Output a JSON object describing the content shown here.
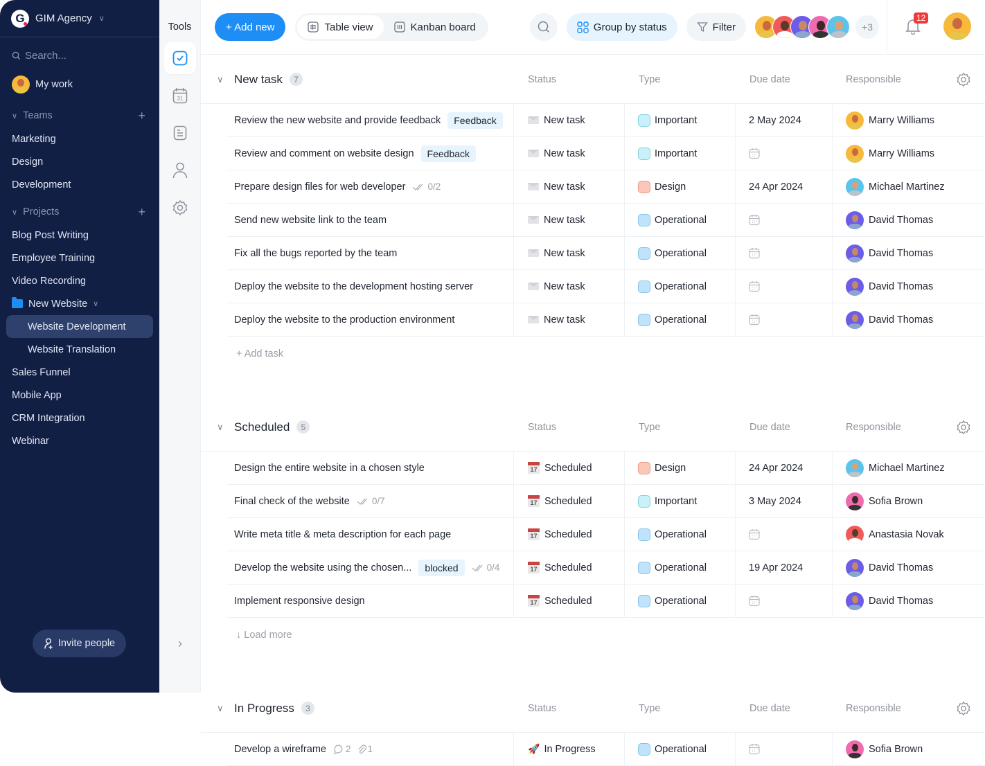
{
  "workspace": {
    "name": "GIM Agency"
  },
  "sidebar": {
    "search_placeholder": "Search...",
    "my_work": "My work",
    "teams_label": "Teams",
    "teams": [
      "Marketing",
      "Design",
      "Development"
    ],
    "projects_label": "Projects",
    "projects": {
      "p0": "Blog Post Writing",
      "p1": "Employee Training",
      "p2": "Video Recording",
      "folder": "New Website",
      "sub0": "Website Development",
      "sub1": "Website Translation",
      "p3": "Sales Funnel",
      "p4": "Mobile App",
      "p5": "CRM Integration",
      "p6": "Webinar"
    },
    "invite": "Invite people"
  },
  "tools": {
    "title": "Tools"
  },
  "toolbar": {
    "add_new": "+ Add new",
    "table_view": "Table view",
    "kanban": "Kanban board",
    "group_by": "Group by status",
    "filter": "Filter",
    "more_members": "+3",
    "notifications": "12"
  },
  "columns": {
    "status": "Status",
    "type": "Type",
    "due": "Due date",
    "responsible": "Responsible"
  },
  "colors": {
    "accent": "#1c8ef5",
    "sidebar": "#121f45",
    "important": "#c9f1f9",
    "design": "#fbc7b9",
    "operational": "#bfe3fb"
  },
  "groups": [
    {
      "title": "New task",
      "count": "7",
      "footer": "+ Add task",
      "rows": [
        {
          "name": "Review the new website and provide feedback",
          "tag": "Feedback",
          "meta": "",
          "status": "New task",
          "type": "Important",
          "due": "2 May 2024",
          "resp": "Marry Williams"
        },
        {
          "name": "Review and comment on website design",
          "tag": "Feedback",
          "meta": "",
          "status": "New task",
          "type": "Important",
          "due": "",
          "resp": "Marry Williams"
        },
        {
          "name": "Prepare design files for web developer",
          "tag": "",
          "meta": "0/2",
          "status": "New task",
          "type": "Design",
          "due": "24 Apr 2024",
          "resp": "Michael Martinez"
        },
        {
          "name": "Send new website link to the team",
          "tag": "",
          "meta": "",
          "status": "New task",
          "type": "Operational",
          "due": "",
          "resp": "David Thomas"
        },
        {
          "name": "Fix all the bugs reported by the team",
          "tag": "",
          "meta": "",
          "status": "New task",
          "type": "Operational",
          "due": "",
          "resp": "David Thomas"
        },
        {
          "name": "Deploy the website to the development hosting server",
          "tag": "",
          "meta": "",
          "status": "New task",
          "type": "Operational",
          "due": "",
          "resp": "David Thomas"
        },
        {
          "name": "Deploy the website to the production environment",
          "tag": "",
          "meta": "",
          "status": "New task",
          "type": "Operational",
          "due": "",
          "resp": "David Thomas"
        }
      ]
    },
    {
      "title": "Scheduled",
      "count": "5",
      "footer": "↓ Load more",
      "rows": [
        {
          "name": "Design the entire website in a chosen style",
          "tag": "",
          "meta": "",
          "status": "Scheduled",
          "type": "Design",
          "due": "24 Apr 2024",
          "resp": "Michael Martinez"
        },
        {
          "name": "Final check of the website",
          "tag": "",
          "meta": "0/7",
          "status": "Scheduled",
          "type": "Important",
          "due": "3 May 2024",
          "resp": "Sofia Brown"
        },
        {
          "name": "Write meta title & meta description for each page",
          "tag": "",
          "meta": "",
          "status": "Scheduled",
          "type": "Operational",
          "due": "",
          "resp": "Anastasia Novak"
        },
        {
          "name": "Develop the website using the chosen...",
          "tag": "blocked",
          "meta": "0/4",
          "status": "Scheduled",
          "type": "Operational",
          "due": "19 Apr 2024",
          "resp": "David Thomas"
        },
        {
          "name": "Implement responsive design",
          "tag": "",
          "meta": "",
          "status": "Scheduled",
          "type": "Operational",
          "due": "",
          "resp": "David Thomas"
        }
      ]
    },
    {
      "title": "In Progress",
      "count": "3",
      "footer": "",
      "rows": [
        {
          "name": "Develop a wireframe",
          "tag": "",
          "comments": "2",
          "attachments": "1",
          "status": "In Progress",
          "type": "Operational",
          "due": "",
          "resp": "Sofia Brown"
        }
      ]
    }
  ]
}
